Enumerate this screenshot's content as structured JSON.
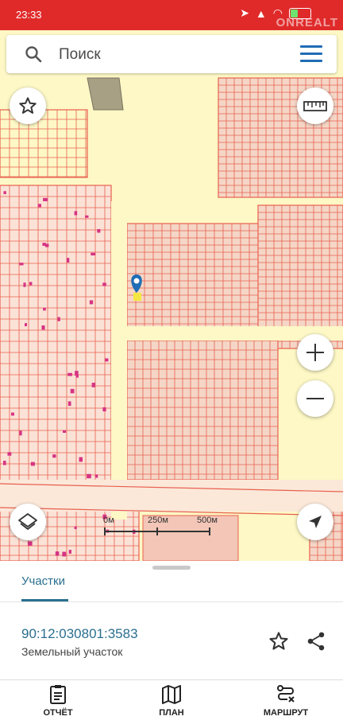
{
  "status_bar": {
    "time": "23:33",
    "battery_level": 0.35,
    "watermark": "ONREALT"
  },
  "search": {
    "placeholder": "Поиск"
  },
  "map": {
    "scale_labels": [
      "0м",
      "250м",
      "500м"
    ],
    "colors": {
      "background": "#fdf8c6",
      "parcel_stroke": "#e8604f",
      "parcel_fill": "#f5d6c6",
      "highlight": "#d63384",
      "marker": "#1f6db5"
    }
  },
  "panel": {
    "tab_label": "Участки",
    "cadastral_number": "90:12:030801:3583",
    "parcel_type": "Земельный участок"
  },
  "bottom_nav": {
    "items": [
      {
        "label": "ОТЧЁТ",
        "icon": "report-icon"
      },
      {
        "label": "ПЛАН",
        "icon": "map-icon"
      },
      {
        "label": "МАРШРУТ",
        "icon": "route-icon"
      }
    ]
  }
}
